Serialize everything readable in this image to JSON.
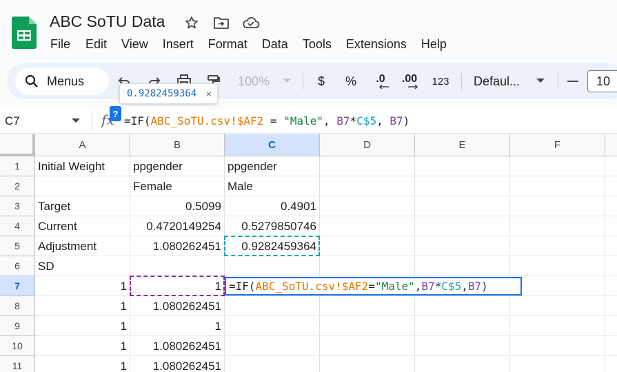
{
  "app": {
    "doc_title": "ABC SoTU Data",
    "menu": [
      "File",
      "Edit",
      "View",
      "Insert",
      "Format",
      "Data",
      "Tools",
      "Extensions",
      "Help"
    ]
  },
  "toolbar": {
    "menus_label": "Menus",
    "zoom": "100%",
    "currency": "$",
    "percent": "%",
    "dec_decrease": ".0",
    "dec_increase": ".00",
    "number_format": "123",
    "font": "Defaul...",
    "font_size": "10"
  },
  "tooltip": {
    "value": "0.9282459364",
    "close": "×"
  },
  "formula_bar": {
    "name_box": "C7",
    "help": "?",
    "fx": "fx",
    "tokens": [
      {
        "t": "=IF(",
        "c": "plain"
      },
      {
        "t": "ABC_SoTU.csv!$AF2",
        "c": "orange"
      },
      {
        "t": " = ",
        "c": "plain"
      },
      {
        "t": "\"Male\"",
        "c": "green"
      },
      {
        "t": ", ",
        "c": "plain"
      },
      {
        "t": "B7",
        "c": "purple"
      },
      {
        "t": "*",
        "c": "plain"
      },
      {
        "t": "C$5",
        "c": "cyan"
      },
      {
        "t": ", ",
        "c": "plain"
      },
      {
        "t": "B7",
        "c": "purple"
      },
      {
        "t": ")",
        "c": "plain"
      }
    ]
  },
  "grid": {
    "columns": [
      "A",
      "B",
      "C",
      "D",
      "E",
      "F"
    ],
    "selected_column": "C",
    "selected_row": 7,
    "rows": [
      {
        "n": "1",
        "cells": [
          "Initial Weight",
          "ppgender",
          "ppgender",
          "",
          "",
          ""
        ]
      },
      {
        "n": "2",
        "cells": [
          "",
          "Female",
          "Male",
          "",
          "",
          ""
        ]
      },
      {
        "n": "3",
        "cells": [
          "Target",
          "0.5099",
          "0.4901",
          "",
          "",
          ""
        ]
      },
      {
        "n": "4",
        "cells": [
          "Current",
          "0.4720149254",
          "0.5279850746",
          "",
          "",
          ""
        ]
      },
      {
        "n": "5",
        "cells": [
          "Adjustment",
          "1.080262451",
          "0.9282459364",
          "",
          "",
          ""
        ]
      },
      {
        "n": "6",
        "cells": [
          "SD",
          "",
          "",
          "",
          "",
          ""
        ]
      },
      {
        "n": "7",
        "cells": [
          "1",
          "1",
          "",
          "",
          "",
          ""
        ]
      },
      {
        "n": "8",
        "cells": [
          "1",
          "1.080262451",
          "",
          "",
          "",
          ""
        ]
      },
      {
        "n": "9",
        "cells": [
          "1",
          "1",
          "",
          "",
          "",
          ""
        ]
      },
      {
        "n": "10",
        "cells": [
          "1",
          "1.080262451",
          "",
          "",
          "",
          ""
        ]
      },
      {
        "n": "11",
        "cells": [
          "1",
          "1.080262451",
          "",
          "",
          "",
          ""
        ]
      }
    ],
    "numeric_cells": [
      "B3",
      "C3",
      "B4",
      "C4",
      "B5",
      "C5",
      "A7",
      "B7",
      "A8",
      "B8",
      "A9",
      "B9",
      "A10",
      "B10",
      "A11",
      "B11"
    ]
  },
  "colors": {
    "accent": "#1a73e8",
    "ref_orange": "#e37400",
    "ref_purple": "#8e24aa",
    "ref_cyan": "#12a4b5",
    "string_green": "#188038"
  }
}
